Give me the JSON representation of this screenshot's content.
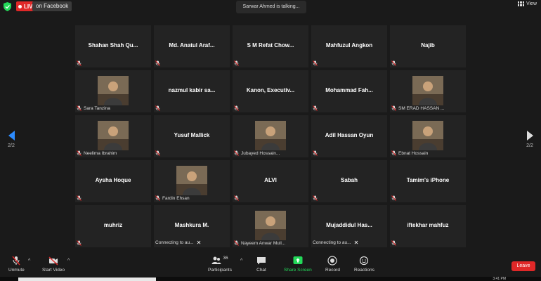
{
  "topbar": {
    "live_label": "LIVE",
    "platform_label": "on Facebook",
    "talking": "Sarwar Ahmed is talking...",
    "view_label": "View"
  },
  "tiles": [
    {
      "name": "Shahan Shah Qu...",
      "muted": true
    },
    {
      "name": "Md. Anatul Araf...",
      "muted": true
    },
    {
      "name": "S M Refat Chow...",
      "muted": true
    },
    {
      "name": "Mahfuzul Angkon",
      "muted": true
    },
    {
      "name": "Najib",
      "muted": true
    },
    {
      "label": "Sara Tanzina",
      "photo": true,
      "muted": true
    },
    {
      "name": "nazmul kabir sa...",
      "muted": true
    },
    {
      "name": "Kanon, Executiv...",
      "muted": true
    },
    {
      "name": "Mohammad Fah...",
      "muted": true
    },
    {
      "label": "SM ERAD HASSAN ...",
      "photo": true,
      "muted": true
    },
    {
      "label": "Neelima Ibrahim",
      "photo": true,
      "muted": true
    },
    {
      "name": "Yusuf Mallick",
      "muted": true
    },
    {
      "label": "Jubayed Hossain...",
      "photo": true,
      "muted": true
    },
    {
      "name": "Adil Hassan Oyun",
      "muted": true
    },
    {
      "label": "Ebnat Hossain",
      "photo": true,
      "muted": true
    },
    {
      "name": "Aysha Hoque",
      "muted": true
    },
    {
      "label": "Fardin Ehsan",
      "photo": true,
      "muted": true
    },
    {
      "name": "ALVI",
      "muted": true
    },
    {
      "name": "Sabah",
      "muted": true
    },
    {
      "name": "Tamim's iPhone",
      "muted": true
    },
    {
      "name": "muhriz",
      "muted": true
    },
    {
      "name": "Mashkura M.",
      "label": "Connecting to au...",
      "muted": false
    },
    {
      "label": "Nayeem Anwar Mull...",
      "photo": true,
      "muted": true
    },
    {
      "name": "Mujaddidul Has...",
      "label": "Connecting to au...",
      "muted": false
    },
    {
      "name": "iftekhar mahfuz",
      "muted": true
    }
  ],
  "pagination": {
    "left": "2/2",
    "right": "2/2"
  },
  "toolbar": {
    "unmute": "Unmute",
    "start_video": "Start Video",
    "participants": "Participants",
    "participant_count": "36",
    "chat": "Chat",
    "share_screen": "Share Screen",
    "record": "Record",
    "reactions": "Reactions",
    "leave": "Leave"
  },
  "taskbar": {
    "time": "3:41 PM"
  },
  "colors": {
    "live": "#e02828",
    "leave": "#e02828",
    "share": "#23d959",
    "nav_arrow": "#2d8cff"
  }
}
